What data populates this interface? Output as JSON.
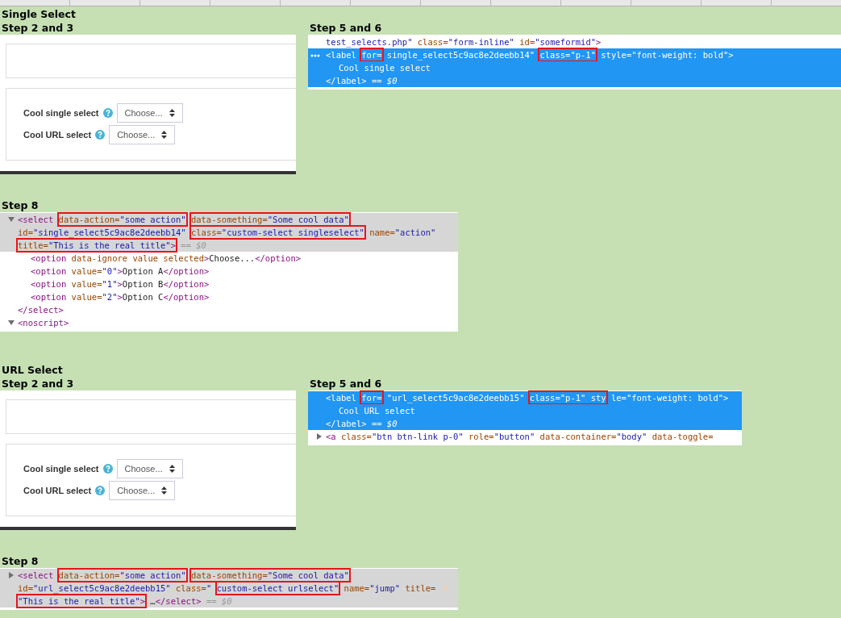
{
  "sections": [
    {
      "title": "Single Select",
      "form": {
        "heading": "Step 2 and 3",
        "fields": [
          {
            "label": "Cool single select",
            "value": "Choose..."
          },
          {
            "label": "Cool URL select",
            "value": "Choose..."
          }
        ]
      },
      "label_snippet": {
        "heading": "Step 5 and 6",
        "focused": true,
        "lines": [
          {
            "selected": false,
            "tokens": [
              {
                "boxed": false,
                "parts": [
                  {
                    "kind": "val",
                    "text": "test_selects.php\""
                  },
                  {
                    "kind": "attr",
                    "text": " class="
                  },
                  {
                    "kind": "val",
                    "text": "\"form-inline\""
                  },
                  {
                    "kind": "attr",
                    "text": " id="
                  },
                  {
                    "kind": "val",
                    "text": "\"someformid\""
                  },
                  {
                    "kind": "tag",
                    "text": ">"
                  }
                ]
              }
            ]
          },
          {
            "selected": true,
            "ellipsis": true,
            "tokens": [
              {
                "boxed": false,
                "parts": [
                  {
                    "kind": "tag",
                    "text": "<label"
                  }
                ]
              },
              {
                "boxed": true,
                "parts": [
                  {
                    "kind": "attr",
                    "text": "for="
                  }
                ]
              },
              {
                "boxed": false,
                "parts": [
                  {
                    "kind": "val",
                    "text": "single_select5c9ac8e2deebb14\""
                  }
                ]
              },
              {
                "boxed": true,
                "parts": [
                  {
                    "kind": "attr",
                    "text": "class="
                  },
                  {
                    "kind": "val",
                    "text": "\"p-1\""
                  }
                ]
              },
              {
                "boxed": false,
                "parts": [
                  {
                    "kind": "attr",
                    "text": "style="
                  },
                  {
                    "kind": "val",
                    "text": "\"font-weight: bold\""
                  },
                  {
                    "kind": "tag",
                    "text": ">"
                  }
                ]
              }
            ],
            "children": [
              {
                "selected": true,
                "tokens": [
                  {
                    "boxed": false,
                    "parts": [
                      {
                        "text": "Cool single select"
                      }
                    ]
                  }
                ]
              }
            ]
          },
          {
            "selected": true,
            "tokens": [
              {
                "boxed": false,
                "parts": [
                  {
                    "kind": "tag",
                    "text": "</label>"
                  }
                ]
              },
              {
                "boxed": false,
                "parts": [
                  {
                    "kind": "dim",
                    "text": "== $0"
                  }
                ]
              }
            ]
          }
        ]
      },
      "select_snippet": {
        "heading": "Step 8",
        "focused": false,
        "lines": [
          {
            "selected": true,
            "expanded": true,
            "tokens": [
              {
                "boxed": false,
                "parts": [
                  {
                    "kind": "tag",
                    "text": "<select"
                  }
                ]
              },
              {
                "boxed": true,
                "parts": [
                  {
                    "kind": "attr",
                    "text": "data-action="
                  },
                  {
                    "kind": "val",
                    "text": "\"some action\""
                  }
                ]
              },
              {
                "boxed": true,
                "parts": [
                  {
                    "kind": "attr",
                    "text": "data-something="
                  },
                  {
                    "kind": "val",
                    "text": "\"Some cool data\""
                  }
                ]
              },
              {
                "boxed": false,
                "parts": [
                  {
                    "kind": "attr",
                    "text": "id="
                  },
                  {
                    "kind": "val",
                    "text": "\"single_select5c9ac8e2deebb14\""
                  }
                ]
              },
              {
                "boxed": true,
                "parts": [
                  {
                    "kind": "attr",
                    "text": "class="
                  },
                  {
                    "kind": "val",
                    "text": "\"custom-select singleselect\""
                  }
                ]
              },
              {
                "boxed": false,
                "parts": [
                  {
                    "kind": "attr",
                    "text": "name="
                  },
                  {
                    "kind": "val",
                    "text": "\"action\""
                  }
                ]
              },
              {
                "boxed": true,
                "parts": [
                  {
                    "kind": "attr",
                    "text": "title="
                  },
                  {
                    "kind": "val",
                    "text": "\"This is the real title\""
                  },
                  {
                    "kind": "tag",
                    "text": ">"
                  }
                ]
              },
              {
                "boxed": false,
                "parts": [
                  {
                    "kind": "dim",
                    "text": "== $0"
                  }
                ]
              }
            ],
            "children": [
              {
                "selected": false,
                "tokens": [
                  {
                    "boxed": false,
                    "parts": [
                      {
                        "kind": "tag",
                        "text": "<option"
                      },
                      {
                        "kind": "attr",
                        "text": " data-ignore value selected"
                      },
                      {
                        "kind": "tag",
                        "text": ">"
                      },
                      {
                        "kind": "text",
                        "text": "Choose..."
                      },
                      {
                        "kind": "tag",
                        "text": "</option>"
                      }
                    ]
                  }
                ]
              },
              {
                "selected": false,
                "tokens": [
                  {
                    "boxed": false,
                    "parts": [
                      {
                        "kind": "tag",
                        "text": "<option"
                      },
                      {
                        "kind": "attr",
                        "text": " value="
                      },
                      {
                        "kind": "val",
                        "text": "\"0\""
                      },
                      {
                        "kind": "tag",
                        "text": ">"
                      },
                      {
                        "kind": "text",
                        "text": "Option A"
                      },
                      {
                        "kind": "tag",
                        "text": "</option>"
                      }
                    ]
                  }
                ]
              },
              {
                "selected": false,
                "tokens": [
                  {
                    "boxed": false,
                    "parts": [
                      {
                        "kind": "tag",
                        "text": "<option"
                      },
                      {
                        "kind": "attr",
                        "text": " value="
                      },
                      {
                        "kind": "val",
                        "text": "\"1\""
                      },
                      {
                        "kind": "tag",
                        "text": ">"
                      },
                      {
                        "kind": "text",
                        "text": "Option B"
                      },
                      {
                        "kind": "tag",
                        "text": "</option>"
                      }
                    ]
                  }
                ]
              },
              {
                "selected": false,
                "tokens": [
                  {
                    "boxed": false,
                    "parts": [
                      {
                        "kind": "tag",
                        "text": "<option"
                      },
                      {
                        "kind": "attr",
                        "text": " value="
                      },
                      {
                        "kind": "val",
                        "text": "\"2\""
                      },
                      {
                        "kind": "tag",
                        "text": ">"
                      },
                      {
                        "kind": "text",
                        "text": "Option C"
                      },
                      {
                        "kind": "tag",
                        "text": "</option>"
                      }
                    ]
                  }
                ]
              }
            ]
          },
          {
            "selected": false,
            "tokens": [
              {
                "boxed": false,
                "parts": [
                  {
                    "kind": "tag",
                    "text": "</select>"
                  }
                ]
              }
            ]
          },
          {
            "selected": false,
            "expanded": true,
            "tokens": [
              {
                "boxed": false,
                "parts": [
                  {
                    "kind": "tag",
                    "text": "<noscript>"
                  }
                ]
              }
            ]
          }
        ]
      }
    },
    {
      "title": "URL Select",
      "form": {
        "heading": "Step 2 and 3",
        "fields": [
          {
            "label": "Cool single select",
            "value": "Choose..."
          },
          {
            "label": "Cool URL select",
            "value": "Choose..."
          }
        ]
      },
      "label_snippet": {
        "heading": "Step 5 and 6",
        "focused": true,
        "lines": [
          {
            "selected": true,
            "tokens": [
              {
                "boxed": false,
                "parts": [
                  {
                    "kind": "tag",
                    "text": "<label"
                  }
                ]
              },
              {
                "boxed": true,
                "parts": [
                  {
                    "kind": "attr",
                    "text": "for="
                  }
                ]
              },
              {
                "boxed": false,
                "parts": [
                  {
                    "kind": "val",
                    "text": "\"url_select5c9ac8e2deebb15\""
                  }
                ]
              },
              {
                "boxed": true,
                "parts": [
                  {
                    "kind": "attr",
                    "text": "class="
                  },
                  {
                    "kind": "val",
                    "text": "\"p-1\""
                  },
                  {
                    "kind": "attr",
                    "text": " sty"
                  }
                ]
              },
              {
                "boxed": false,
                "parts": [
                  {
                    "kind": "attr",
                    "text": "le="
                  },
                  {
                    "kind": "val",
                    "text": "\"font-weight: bold\""
                  },
                  {
                    "kind": "tag",
                    "text": ">"
                  }
                ]
              }
            ],
            "children": [
              {
                "selected": true,
                "tokens": [
                  {
                    "boxed": false,
                    "parts": [
                      {
                        "text": "Cool URL select"
                      }
                    ]
                  }
                ]
              }
            ]
          },
          {
            "selected": true,
            "tokens": [
              {
                "boxed": false,
                "parts": [
                  {
                    "kind": "tag",
                    "text": "</label>"
                  }
                ]
              },
              {
                "boxed": false,
                "parts": [
                  {
                    "kind": "dim",
                    "text": "== $0"
                  }
                ]
              }
            ]
          },
          {
            "selected": false,
            "expanded": false,
            "tokens": [
              {
                "boxed": false,
                "parts": [
                  {
                    "kind": "tag",
                    "text": "<a"
                  },
                  {
                    "kind": "attr",
                    "text": " class="
                  },
                  {
                    "kind": "val",
                    "text": "\"btn btn-link p-0\""
                  },
                  {
                    "kind": "attr",
                    "text": " role="
                  },
                  {
                    "kind": "val",
                    "text": "\"button\""
                  },
                  {
                    "kind": "attr",
                    "text": " data-container="
                  },
                  {
                    "kind": "val",
                    "text": "\"body\""
                  },
                  {
                    "kind": "attr",
                    "text": " data-toggle="
                  }
                ]
              }
            ]
          }
        ]
      },
      "select_snippet": {
        "heading": "Step 8",
        "focused": false,
        "lines": [
          {
            "selected": true,
            "expanded": false,
            "tokens": [
              {
                "boxed": false,
                "parts": [
                  {
                    "kind": "tag",
                    "text": "<select"
                  }
                ]
              },
              {
                "boxed": true,
                "parts": [
                  {
                    "kind": "attr",
                    "text": "data-action="
                  },
                  {
                    "kind": "val",
                    "text": "\"some action\""
                  }
                ]
              },
              {
                "boxed": true,
                "parts": [
                  {
                    "kind": "attr",
                    "text": "data-something="
                  },
                  {
                    "kind": "val",
                    "text": "\"Some cool data\""
                  }
                ]
              },
              {
                "boxed": false,
                "parts": [
                  {
                    "kind": "attr",
                    "text": "id="
                  },
                  {
                    "kind": "val",
                    "text": "\"url_select5c9ac8e2deebb15\""
                  },
                  {
                    "kind": "attr",
                    "text": " class="
                  },
                  {
                    "kind": "val",
                    "text": "\""
                  }
                ]
              },
              {
                "boxed": true,
                "parts": [
                  {
                    "kind": "val",
                    "text": "custom-select urlselect\""
                  }
                ]
              },
              {
                "boxed": false,
                "parts": [
                  {
                    "kind": "attr",
                    "text": "name="
                  },
                  {
                    "kind": "val",
                    "text": "\"jump\""
                  },
                  {
                    "kind": "attr",
                    "text": " title="
                  }
                ]
              },
              {
                "boxed": true,
                "parts": [
                  {
                    "kind": "val",
                    "text": "\"This is the real title\""
                  },
                  {
                    "kind": "tag",
                    "text": ">"
                  }
                ]
              },
              {
                "boxed": false,
                "parts": [
                  {
                    "kind": "text",
                    "text": "…"
                  },
                  {
                    "kind": "tag",
                    "text": "</select>"
                  }
                ]
              },
              {
                "boxed": false,
                "parts": [
                  {
                    "kind": "dim",
                    "text": "== $0"
                  }
                ]
              }
            ]
          }
        ]
      }
    }
  ]
}
